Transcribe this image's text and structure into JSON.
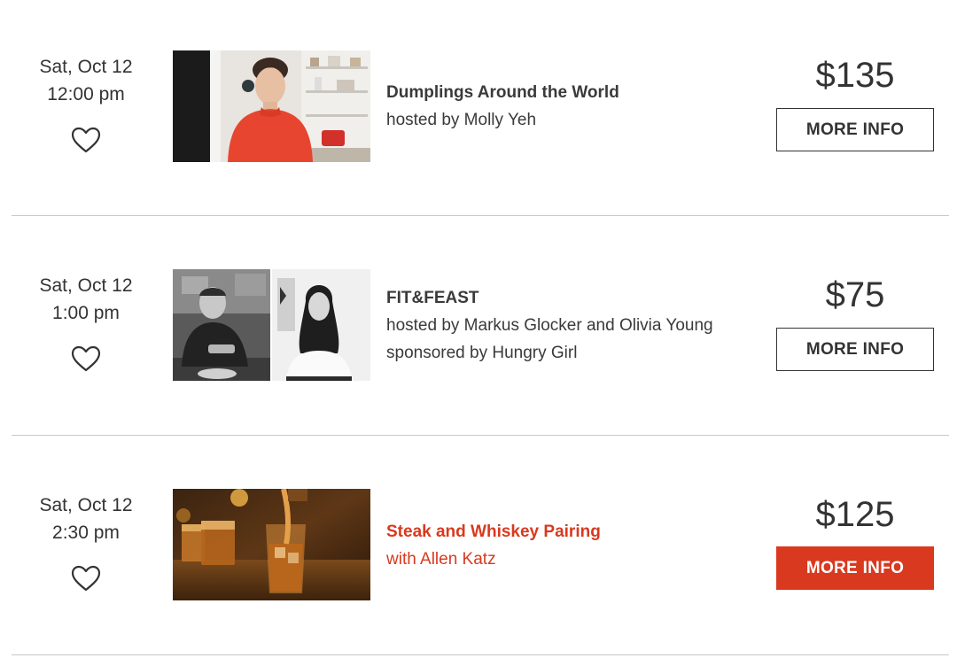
{
  "colors": {
    "accent": "#d9391f",
    "text": "#333333",
    "divider": "#c8c8c8"
  },
  "events": [
    {
      "date": "Sat, Oct 12",
      "time": "12:00 pm",
      "title": "Dumplings Around the World",
      "host": "hosted by Molly Yeh",
      "sponsor": "",
      "price": "$135",
      "button": "MORE INFO",
      "highlighted": false,
      "image": "chef-in-kitchen-photo"
    },
    {
      "date": "Sat, Oct 12",
      "time": "1:00 pm",
      "title": "FIT&FEAST",
      "host": "hosted by Markus Glocker and Olivia Young",
      "sponsor": "sponsored by Hungry Girl",
      "price": "$75",
      "button": "MORE INFO",
      "highlighted": false,
      "image": "two-hosts-photo"
    },
    {
      "date": "Sat, Oct 12",
      "time": "2:30 pm",
      "title": "Steak and Whiskey Pairing",
      "host": "with Allen Katz",
      "sponsor": "",
      "price": "$125",
      "button": "MORE INFO",
      "highlighted": true,
      "image": "whiskey-glasses-photo"
    }
  ]
}
